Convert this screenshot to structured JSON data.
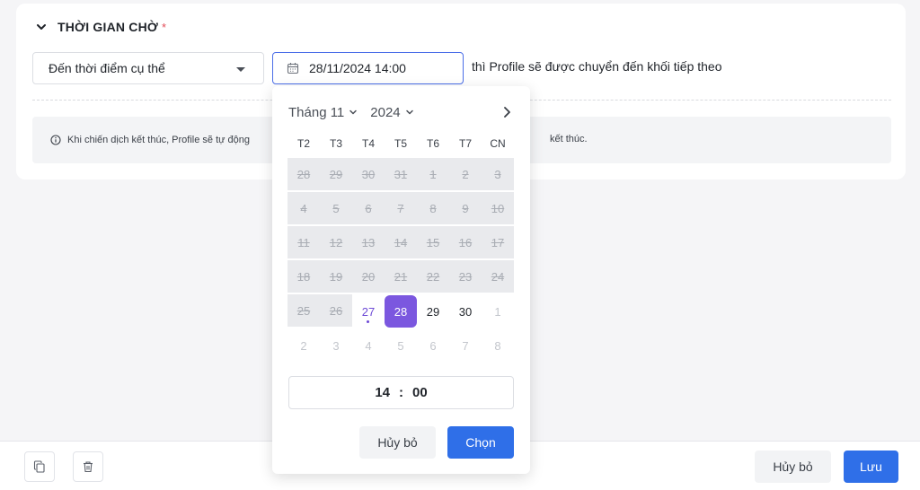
{
  "section": {
    "title": "THỜI GIAN CHỜ",
    "required_mark": "*"
  },
  "wait_type_select": {
    "value": "Đến thời điểm cụ thể"
  },
  "date_input": {
    "value": "28/11/2024 14:00"
  },
  "inline_text": "thì Profile sẽ được chuyển đến khối tiếp theo",
  "info": {
    "text_left": "Khi chiến dịch kết thúc, Profile sẽ tự động",
    "text_right": "kết thúc."
  },
  "calendar": {
    "month_label": "Tháng 11",
    "year_label": "2024",
    "weekdays": [
      "T2",
      "T3",
      "T4",
      "T5",
      "T6",
      "T7",
      "CN"
    ],
    "weeks": [
      [
        {
          "d": "28",
          "s": "disabled"
        },
        {
          "d": "29",
          "s": "disabled"
        },
        {
          "d": "30",
          "s": "disabled"
        },
        {
          "d": "31",
          "s": "disabled"
        },
        {
          "d": "1",
          "s": "disabled"
        },
        {
          "d": "2",
          "s": "disabled"
        },
        {
          "d": "3",
          "s": "disabled"
        }
      ],
      [
        {
          "d": "4",
          "s": "disabled"
        },
        {
          "d": "5",
          "s": "disabled"
        },
        {
          "d": "6",
          "s": "disabled"
        },
        {
          "d": "7",
          "s": "disabled"
        },
        {
          "d": "8",
          "s": "disabled"
        },
        {
          "d": "9",
          "s": "disabled"
        },
        {
          "d": "10",
          "s": "disabled"
        }
      ],
      [
        {
          "d": "11",
          "s": "disabled"
        },
        {
          "d": "12",
          "s": "disabled"
        },
        {
          "d": "13",
          "s": "disabled"
        },
        {
          "d": "14",
          "s": "disabled"
        },
        {
          "d": "15",
          "s": "disabled"
        },
        {
          "d": "16",
          "s": "disabled"
        },
        {
          "d": "17",
          "s": "disabled"
        }
      ],
      [
        {
          "d": "18",
          "s": "disabled"
        },
        {
          "d": "19",
          "s": "disabled"
        },
        {
          "d": "20",
          "s": "disabled"
        },
        {
          "d": "21",
          "s": "disabled"
        },
        {
          "d": "22",
          "s": "disabled"
        },
        {
          "d": "23",
          "s": "disabled"
        },
        {
          "d": "24",
          "s": "disabled"
        }
      ],
      [
        {
          "d": "25",
          "s": "disabled"
        },
        {
          "d": "26",
          "s": "disabled"
        },
        {
          "d": "27",
          "s": "today"
        },
        {
          "d": "28",
          "s": "selected"
        },
        {
          "d": "29",
          "s": "normal"
        },
        {
          "d": "30",
          "s": "normal"
        },
        {
          "d": "1",
          "s": "muted"
        }
      ],
      [
        {
          "d": "2",
          "s": "muted"
        },
        {
          "d": "3",
          "s": "muted"
        },
        {
          "d": "4",
          "s": "muted"
        },
        {
          "d": "5",
          "s": "muted"
        },
        {
          "d": "6",
          "s": "muted"
        },
        {
          "d": "7",
          "s": "muted"
        },
        {
          "d": "8",
          "s": "muted"
        }
      ]
    ],
    "time": {
      "hour": "14",
      "minute": "00",
      "separator": ":"
    },
    "cancel_label": "Hủy bỏ",
    "choose_label": "Chọn"
  },
  "footer": {
    "cancel_label": "Hủy bỏ",
    "save_label": "Lưu"
  },
  "colors": {
    "primary": "#2f6fe8",
    "selected_day": "#7b57df",
    "required": "#e34d59"
  },
  "icons": [
    "chevron-down-icon",
    "calendar-icon",
    "info-icon",
    "chevron-right-icon",
    "copy-icon",
    "trash-icon"
  ]
}
